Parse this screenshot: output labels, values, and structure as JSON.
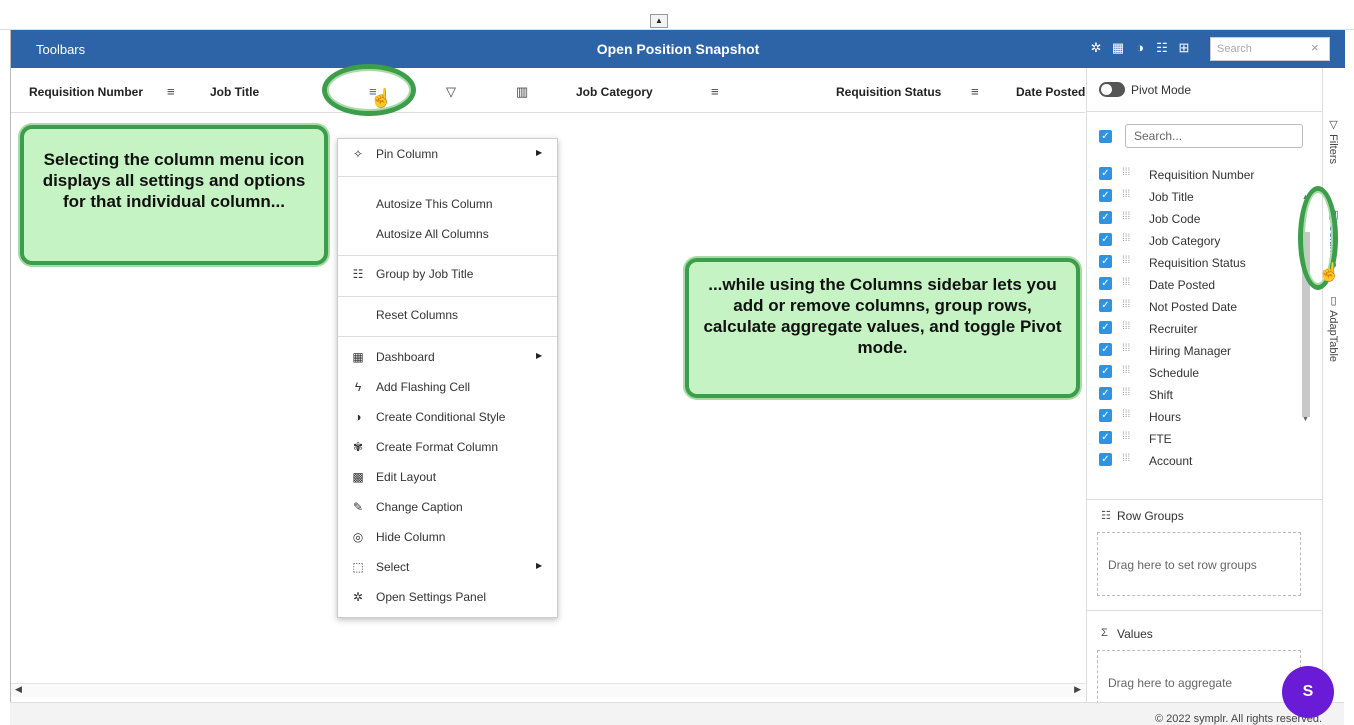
{
  "topbar": {
    "collapse_glyph": "▲"
  },
  "titlebar": {
    "toolbars_label": "Toolbars",
    "title": "Open Position Snapshot",
    "icons": [
      "gear-icon",
      "grid-icon",
      "contrast-icon",
      "list-filter-icon",
      "layout-icon"
    ],
    "search_placeholder": "Search",
    "close_glyph": "×"
  },
  "grid_header": {
    "columns": [
      {
        "label": "Requisition Number"
      },
      {
        "label": "Job Title"
      },
      {
        "label": "Job Category"
      },
      {
        "label": "Requisition Status"
      },
      {
        "label": "Date Posted"
      }
    ],
    "menu_glyph": "≡",
    "filter_glyph": "▽",
    "columns_glyph": "▥"
  },
  "column_menu": {
    "items": [
      {
        "icon": "pin-icon",
        "glyph": "✧",
        "label": "Pin Column",
        "submenu": true
      },
      {
        "icon": "",
        "glyph": "",
        "label": "Autosize This Column",
        "submenu": false
      },
      {
        "icon": "",
        "glyph": "",
        "label": "Autosize All Columns",
        "submenu": false
      },
      {
        "icon": "group-icon",
        "glyph": "☷",
        "label": "Group by Job Title",
        "submenu": false
      },
      {
        "icon": "",
        "glyph": "",
        "label": "Reset Columns",
        "submenu": false
      },
      {
        "icon": "dashboard-icon",
        "glyph": "▦",
        "label": "Dashboard",
        "submenu": true
      },
      {
        "icon": "flash-icon",
        "glyph": "ϟ",
        "label": "Add Flashing Cell",
        "submenu": false
      },
      {
        "icon": "contrast-icon",
        "glyph": "◑",
        "label": "Create Conditional Style",
        "submenu": false
      },
      {
        "icon": "palette-icon",
        "glyph": "✾",
        "label": "Create Format Column",
        "submenu": false
      },
      {
        "icon": "layout-grid-icon",
        "glyph": "▩",
        "label": "Edit Layout",
        "submenu": false
      },
      {
        "icon": "pencil-icon",
        "glyph": "✎",
        "label": "Change Caption",
        "submenu": false
      },
      {
        "icon": "eye-slash-icon",
        "glyph": "◎",
        "label": "Hide Column",
        "submenu": false
      },
      {
        "icon": "select-icon",
        "glyph": "⬚",
        "label": "Select",
        "submenu": true
      },
      {
        "icon": "gear-icon",
        "glyph": "✲",
        "label": "Open Settings Panel",
        "submenu": false
      }
    ],
    "submenu_glyph": "▶"
  },
  "callouts": {
    "column_menu": "Selecting the column menu icon displays all settings and options for that individual column...",
    "columns_sidebar": "...while using the Columns sidebar lets you add or remove columns, group rows, calculate aggregate values, and toggle Pivot mode."
  },
  "sidebar": {
    "pivot_label": "Pivot Mode",
    "search_placeholder": "Search...",
    "columns": [
      "Requisition Number",
      "Job Title",
      "Job Code",
      "Job Category",
      "Requisition Status",
      "Date Posted",
      "Not Posted Date",
      "Recruiter",
      "Hiring Manager",
      "Schedule",
      "Shift",
      "Hours",
      "FTE",
      "Account"
    ],
    "row_groups_label": "Row Groups",
    "row_groups_drop": "Drag here to set row groups",
    "values_label": "Values",
    "values_drop": "Drag here to aggregate",
    "check_glyph": "✓",
    "grip_glyph": "⁞⁞⁞"
  },
  "side_tabs": {
    "filters": "Filters",
    "columns": "Columns",
    "adaptable": "AdapTable"
  },
  "footer": {
    "copyright": "© 2022 symplr. All rights reserved."
  },
  "help_button": {
    "label": "S"
  },
  "colors": {
    "header_blue": "#2d64a7",
    "callout_green": "#c6f3c3",
    "callout_border": "#3c9e4a",
    "checkbox_blue": "#2f93e0",
    "fab_purple": "#6a1bd6"
  }
}
